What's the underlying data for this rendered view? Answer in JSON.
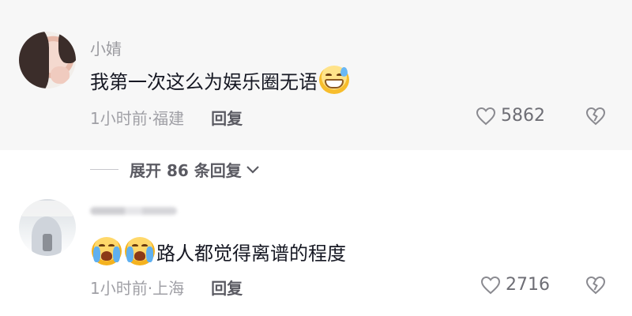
{
  "comments": [
    {
      "username": "小婧",
      "text": "我第一次这么为娱乐圈无语",
      "trailing_emoji": "grinning-sweat-emoji",
      "time_location": "1小时前·福建",
      "reply_label": "回复",
      "like_count": "5862"
    },
    {
      "username": "",
      "leading_emojis": [
        "loudly-crying-emoji",
        "loudly-crying-emoji"
      ],
      "text": "路人都觉得离谱的程度",
      "time_location": "1小时前·上海",
      "reply_label": "回复",
      "like_count": "2716"
    }
  ],
  "expand_replies": {
    "label": "展开 86 条回复"
  },
  "colors": {
    "text": "#161823",
    "meta": "#a0a0a6",
    "highlight_bg": "#f7f7f7"
  }
}
